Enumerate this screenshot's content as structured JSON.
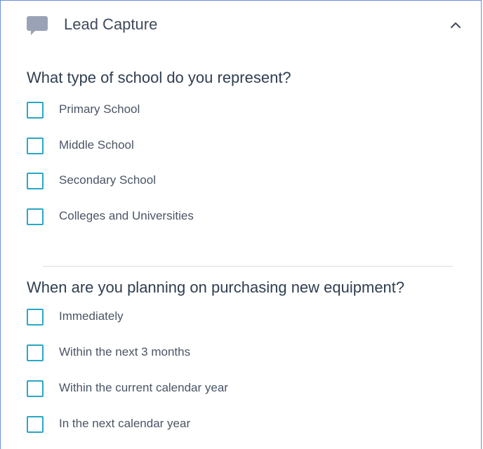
{
  "header": {
    "title": "Lead Capture",
    "icon": "chat-bubble-icon",
    "collapse_icon": "chevron-up-icon"
  },
  "sections": [
    {
      "question": "What type of school do you represent?",
      "options": [
        {
          "label": "Primary School",
          "checked": false
        },
        {
          "label": "Middle School",
          "checked": false
        },
        {
          "label": "Secondary School",
          "checked": false
        },
        {
          "label": "Colleges and Universities",
          "checked": false
        }
      ]
    },
    {
      "question": "When are you planning on purchasing new equipment?",
      "options": [
        {
          "label": "Immediately",
          "checked": false
        },
        {
          "label": "Within the next 3 months",
          "checked": false
        },
        {
          "label": "Within the current calendar year",
          "checked": false
        },
        {
          "label": "In the next calendar year",
          "checked": false
        }
      ]
    }
  ],
  "colors": {
    "accent": "#2aa7c7",
    "border": "#6a8fd8",
    "icon": "#9aa3b6",
    "text": "#2f3e50"
  }
}
